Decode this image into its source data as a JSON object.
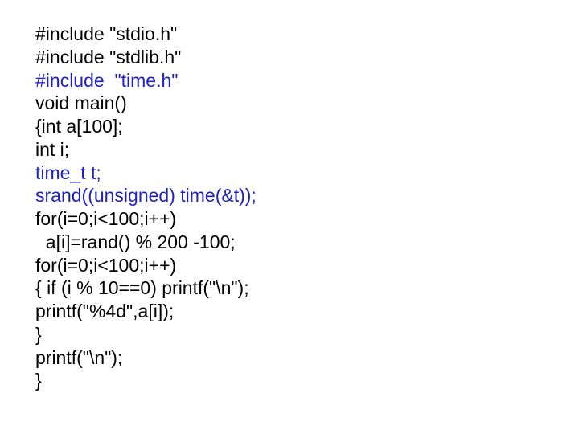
{
  "code": {
    "lines": [
      {
        "text": "#include \"stdio.h\"",
        "highlight": false
      },
      {
        "text": "#include \"stdlib.h\"",
        "highlight": false
      },
      {
        "text": "#include  \"time.h\"",
        "highlight": true
      },
      {
        "text": "void main()",
        "highlight": false
      },
      {
        "text": "{int a[100];",
        "highlight": false
      },
      {
        "text": "int i;",
        "highlight": false
      },
      {
        "text": "time_t t;",
        "highlight": true
      },
      {
        "text": "srand((unsigned) time(&t));",
        "highlight": true
      },
      {
        "text": "for(i=0;i<100;i++)",
        "highlight": false
      },
      {
        "text": "  a[i]=rand() % 200 -100;",
        "highlight": false
      },
      {
        "text": "for(i=0;i<100;i++)",
        "highlight": false
      },
      {
        "text": "{ if (i % 10==0) printf(\"\\n\");",
        "highlight": false
      },
      {
        "text": "printf(\"%4d\",a[i]);",
        "highlight": false
      },
      {
        "text": "}",
        "highlight": false
      },
      {
        "text": "printf(\"\\n\");",
        "highlight": false
      },
      {
        "text": "}",
        "highlight": false
      }
    ]
  }
}
